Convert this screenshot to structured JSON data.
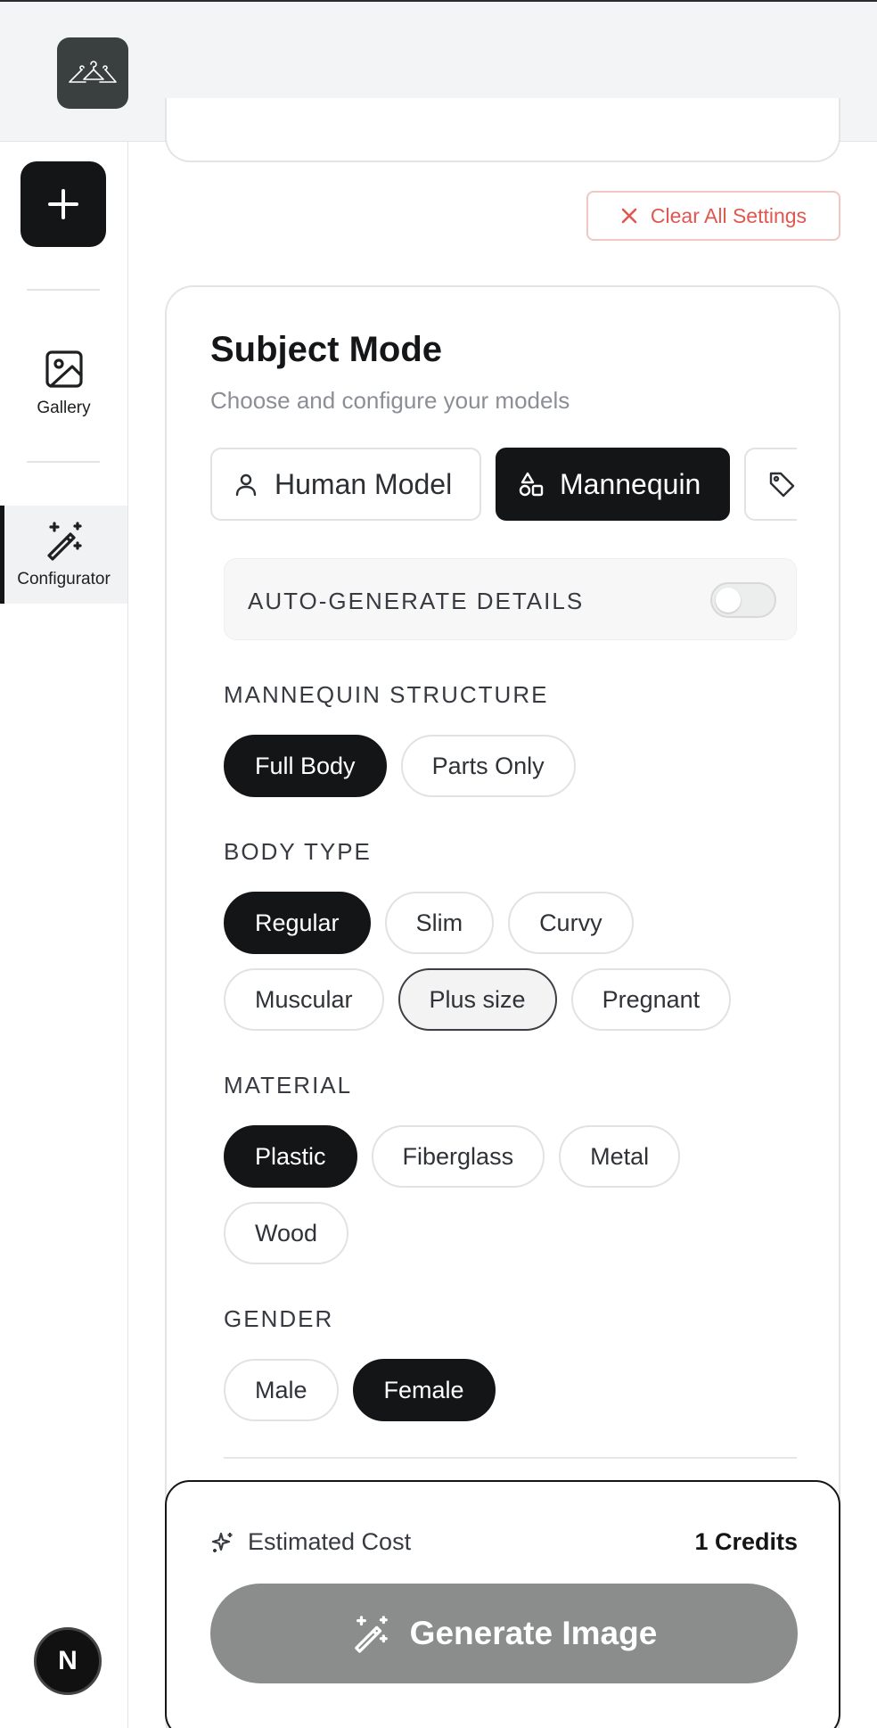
{
  "sidebar": {
    "items": [
      {
        "label": "Gallery",
        "icon": "image-icon"
      },
      {
        "label": "Configurator",
        "icon": "magic-wand-icon"
      }
    ],
    "avatar_letter": "N"
  },
  "actions": {
    "clear_all": "Clear All Settings"
  },
  "subject_mode": {
    "title": "Subject Mode",
    "subtitle": "Choose and configure your models",
    "tabs": [
      {
        "label": "Human Model",
        "icon": "user-icon",
        "selected": false
      },
      {
        "label": "Mannequin",
        "icon": "shapes-icon",
        "selected": true
      },
      {
        "label": "",
        "icon": "tag-icon",
        "selected": false
      }
    ],
    "auto_generate": {
      "label": "AUTO-GENERATE DETAILS",
      "enabled": false
    }
  },
  "sections": {
    "structure": {
      "label": "MANNEQUIN STRUCTURE",
      "options": [
        "Full Body",
        "Parts Only"
      ],
      "selected": "Full Body"
    },
    "body_type": {
      "label": "BODY TYPE",
      "options": [
        "Regular",
        "Slim",
        "Curvy",
        "Muscular",
        "Plus size",
        "Pregnant"
      ],
      "selected": "Regular"
    },
    "material": {
      "label": "MATERIAL",
      "options": [
        "Plastic",
        "Fiberglass",
        "Metal",
        "Wood"
      ],
      "selected": "Plastic"
    },
    "gender": {
      "label": "GENDER",
      "options": [
        "Male",
        "Female"
      ],
      "selected": "Female"
    }
  },
  "cost": {
    "label": "Estimated Cost",
    "value": "1 Credits",
    "generate_label": "Generate Image"
  },
  "colors": {
    "accent_dark": "#141516",
    "danger": "#e0574f",
    "button_disabled": "#8b8c8c"
  }
}
